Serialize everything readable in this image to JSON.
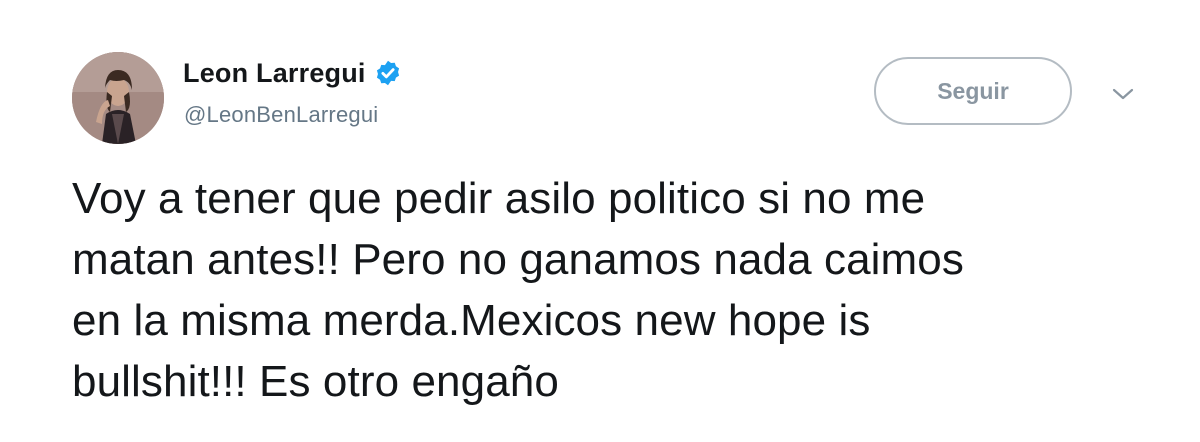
{
  "tweet": {
    "author": {
      "display_name": "Leon Larregui",
      "handle": "@LeonBenLarregui",
      "verified": true,
      "avatar_icon": "profile-photo",
      "verified_icon": "verified-badge-icon"
    },
    "follow_button_label": "Seguir",
    "menu_icon": "chevron-down-icon",
    "text": "Voy a tener que pedir asilo politico si no me\nmatan antes!! Pero no ganamos nada caimos\nen la misma merda.Mexicos new hope is\nbullshit!!! Es otro engaño"
  },
  "colors": {
    "name_text": "#14171a",
    "handle_text": "#657786",
    "verified_blue": "#1da1f2",
    "button_border": "#b4bcc3",
    "button_text": "#8a96a1",
    "background": "#ffffff"
  }
}
